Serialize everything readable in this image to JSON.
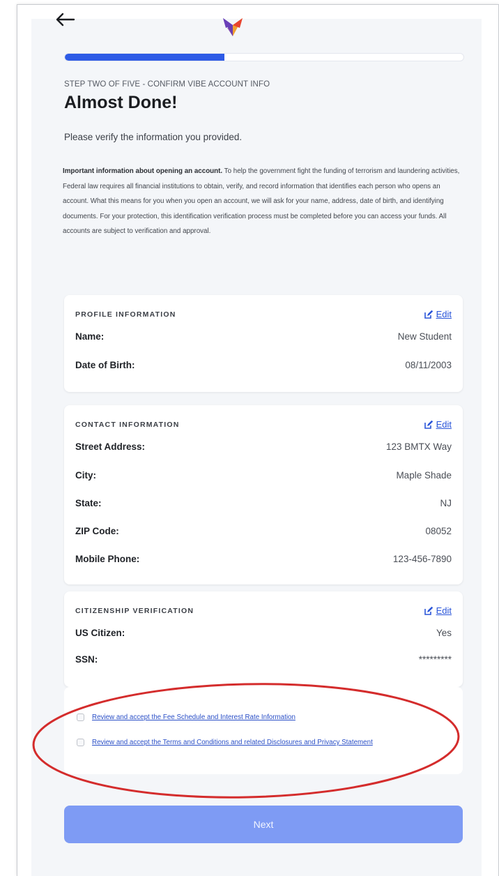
{
  "header": {
    "back_icon": "back-arrow-icon",
    "logo_icon": "brand-logo-icon",
    "progress_fraction": 0.4
  },
  "step_label": "STEP TWO OF FIVE - CONFIRM VIBE ACCOUNT INFO",
  "title": "Almost Done!",
  "subtitle": "Please verify the information you provided.",
  "notice": {
    "bold": "Important information about opening an account.",
    "text": " To help the government fight the funding of terrorism and laundering activities, Federal law requires all financial institutions to obtain, verify, and record information that identifies each person who opens an account. What this means for you when you open an account, we will ask for your name, address, date of birth, and identifying documents. For your protection, this identification verification process must be completed before you can access your funds. All accounts are subject to verification and approval."
  },
  "profile": {
    "title": "PROFILE INFORMATION",
    "edit_label": "Edit",
    "rows": [
      {
        "label": "Name:",
        "value": "New Student"
      },
      {
        "label": "Date of Birth:",
        "value": "08/11/2003"
      }
    ]
  },
  "contact": {
    "title": "CONTACT INFORMATION",
    "edit_label": "Edit",
    "rows": [
      {
        "label": "Street Address:",
        "value": "123 BMTX Way"
      },
      {
        "label": "City:",
        "value": "Maple Shade"
      },
      {
        "label": "State:",
        "value": "NJ"
      },
      {
        "label": "ZIP Code:",
        "value": "08052"
      },
      {
        "label": "Mobile Phone:",
        "value": "123-456-7890"
      }
    ]
  },
  "citizenship": {
    "title": "CITIZENSHIP VERIFICATION",
    "edit_label": "Edit",
    "rows": [
      {
        "label": "US Citizen:",
        "value": "Yes"
      },
      {
        "label": "SSN:",
        "value": "*********"
      }
    ]
  },
  "agreements": [
    {
      "label": "Review and accept the Fee Schedule and Interest Rate Information",
      "checked": false
    },
    {
      "label": "Review and accept the Terms and Conditions and related Disclosures and Privacy Statement",
      "checked": false
    }
  ],
  "next_label": "Next",
  "colors": {
    "accent": "#2e5be6",
    "link": "#2a55d9",
    "next_button": "#7e9bf4",
    "annotation_oval": "#d42c2c",
    "background": "#f4f6f9"
  }
}
